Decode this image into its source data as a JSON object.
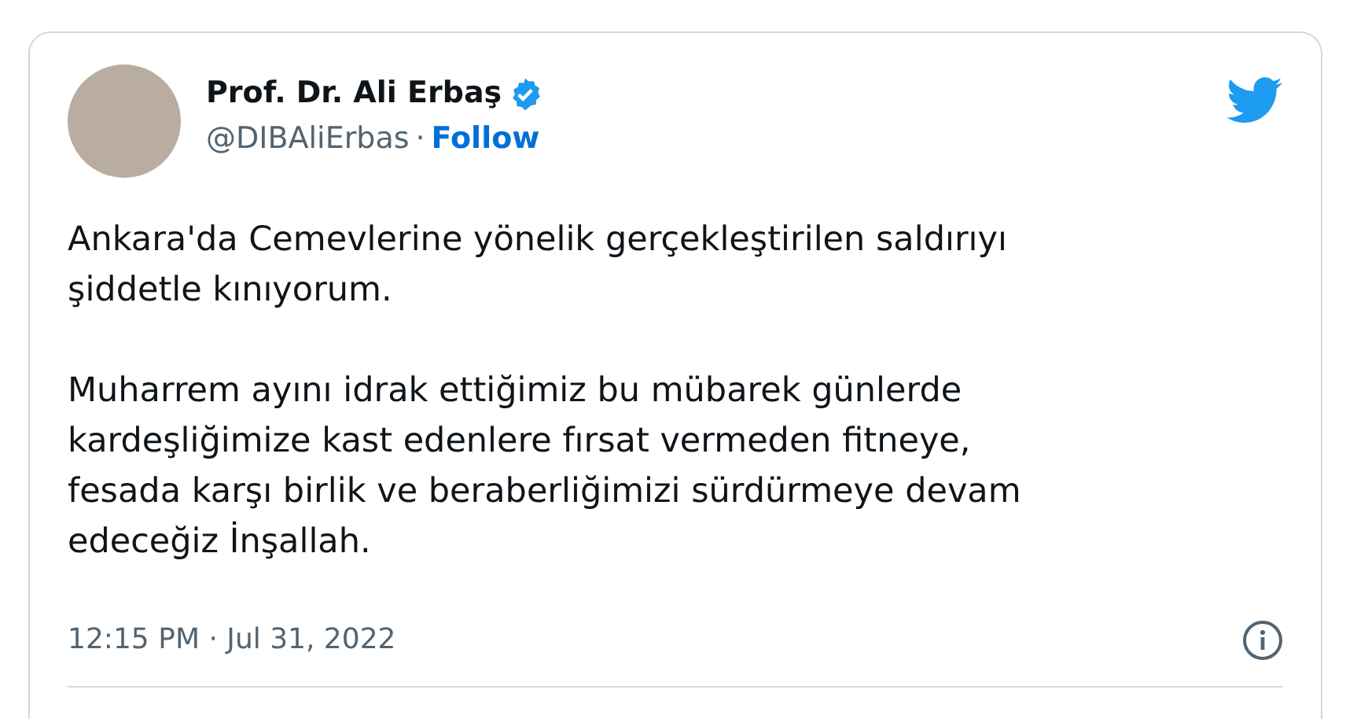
{
  "tweet": {
    "author_name": "Prof. Dr. Ali Erbaş",
    "verified": true,
    "handle": "@DIBAliErbas",
    "separator": "·",
    "follow": "Follow",
    "paragraphs": [
      [
        "Ankara'da Cemevlerine yönelik gerçekleştirilen saldırıyı",
        "şiddetle kınıyorum."
      ],
      [
        "Muharrem ayını idrak ettiğimiz bu mübarek günlerde",
        "kardeşliğimize kast edenlere fırsat vermeden fitneye,",
        "fesada karşı birlik ve beraberliğimizi sürdürmeye devam",
        "edeceğiz İnşallah."
      ]
    ],
    "timestamp": "12:15 PM · Jul 31, 2022"
  }
}
